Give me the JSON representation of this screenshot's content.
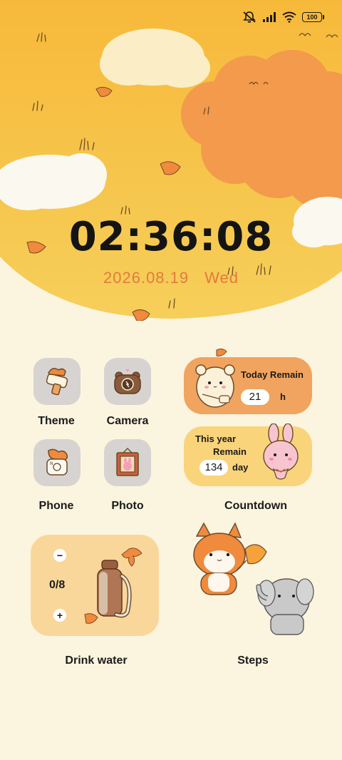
{
  "status_bar": {
    "icons": [
      "mute-vibrate-icon",
      "signal-icon",
      "wifi-icon"
    ],
    "battery": "100"
  },
  "clock": {
    "time": "02:36:08"
  },
  "date": {
    "date": "2026.08.19",
    "weekday": "Wed"
  },
  "apps": [
    {
      "label": "Theme",
      "icon": "paint-brush-icon"
    },
    {
      "label": "Camera",
      "icon": "bear-camera-icon"
    },
    {
      "label": "Phone",
      "icon": "phone-icon"
    },
    {
      "label": "Photo",
      "icon": "picture-frame-icon"
    }
  ],
  "countdown": {
    "today": {
      "label": "Today Remain",
      "value": "21",
      "unit": "h"
    },
    "year": {
      "label_line1": "This year",
      "label_line2": "Remain",
      "value": "134",
      "unit": "day"
    },
    "title": "Countdown"
  },
  "drink_water": {
    "count": "0/8",
    "minus": "−",
    "plus": "+",
    "title": "Drink water"
  },
  "steps": {
    "title": "Steps"
  },
  "colors": {
    "background": "#fbf4df",
    "sky": "#f6c246",
    "tree": "#f39a4c",
    "accent_date": "#e27b3c",
    "today_widget": "#f0a45f",
    "year_widget": "#fad47b",
    "water_widget": "#f9d79b"
  }
}
